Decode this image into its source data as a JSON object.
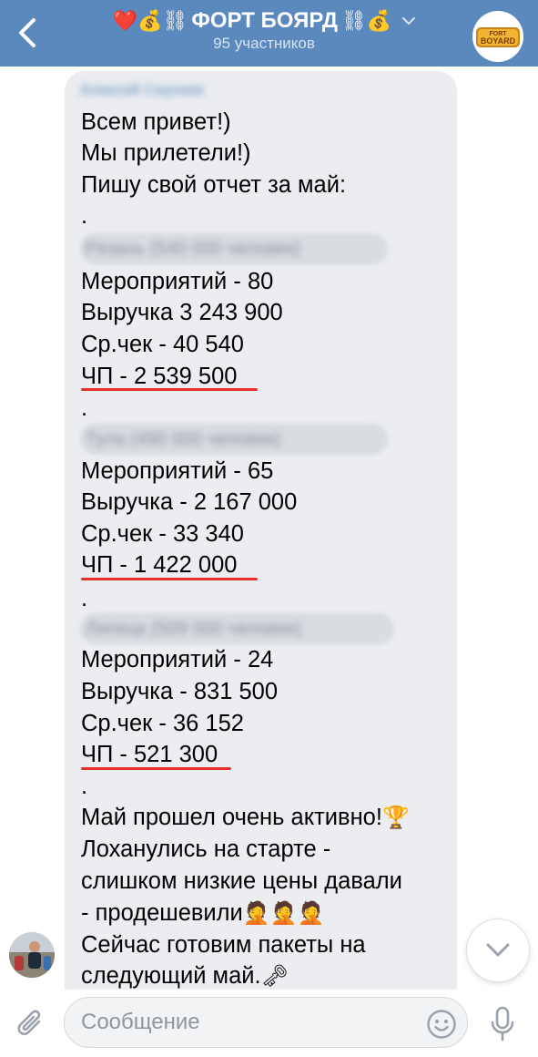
{
  "header": {
    "title": "ФОРТ БОЯРД",
    "title_prefix": "❤️💰⛓",
    "title_suffix": "⛓💰",
    "subtitle": "95 участников",
    "avatar_logo": "FORT BOYARD",
    "icons": {
      "back": "chevron-left-icon",
      "expand": "chevron-down-icon"
    }
  },
  "message": {
    "sender_name": "Алексей Сергеев",
    "greeting": [
      "Всем привет!)",
      "Мы прилетели!)",
      "Пишу свой отчет за май:"
    ],
    "separator": ".",
    "cities": [
      {
        "name_blurred": "Рязань (540 000 человек)",
        "stats": [
          "Мероприятий - 80",
          "Выручка 3 243 900",
          "Ср.чек - 40 540"
        ],
        "net_profit": "ЧП - 2 539 500"
      },
      {
        "name_blurred": "Тула (490 000 человек)",
        "stats": [
          "Мероприятий - 65",
          "Выручка - 2 167 000",
          "Ср.чек - 33 340"
        ],
        "net_profit": "ЧП - 1 422 000"
      },
      {
        "name_blurred": "Липецк (509 000 человек)",
        "stats": [
          "Мероприятий - 24",
          "Выручка - 831 500",
          "Ср.чек - 36 152"
        ],
        "net_profit": "ЧП - 521 300"
      }
    ],
    "closing": [
      {
        "text": "Май прошел очень активно!",
        "emoji": "🏆"
      },
      {
        "text": "Лоханулись на старте -",
        "emoji": ""
      },
      {
        "text": "слишком низкие цены давали",
        "emoji": ""
      },
      {
        "text": "- продешевили",
        "emoji": "🤦🤦🤦"
      },
      {
        "text": "Сейчас готовим пакеты на",
        "emoji": ""
      },
      {
        "text": "следующий май.",
        "emoji": "🗝"
      }
    ],
    "highlight_color": "#e8302a"
  },
  "composer": {
    "placeholder": "Сообщение",
    "value": "",
    "icons": {
      "attach": "paperclip-icon",
      "sticker": "smiley-icon",
      "voice": "microphone-icon"
    }
  },
  "scroll_down": {
    "icon": "chevron-down-icon"
  },
  "colors": {
    "header_bg": "#5b88bd",
    "bubble_bg": "#ebedf0",
    "accent": "#5b88bd"
  }
}
